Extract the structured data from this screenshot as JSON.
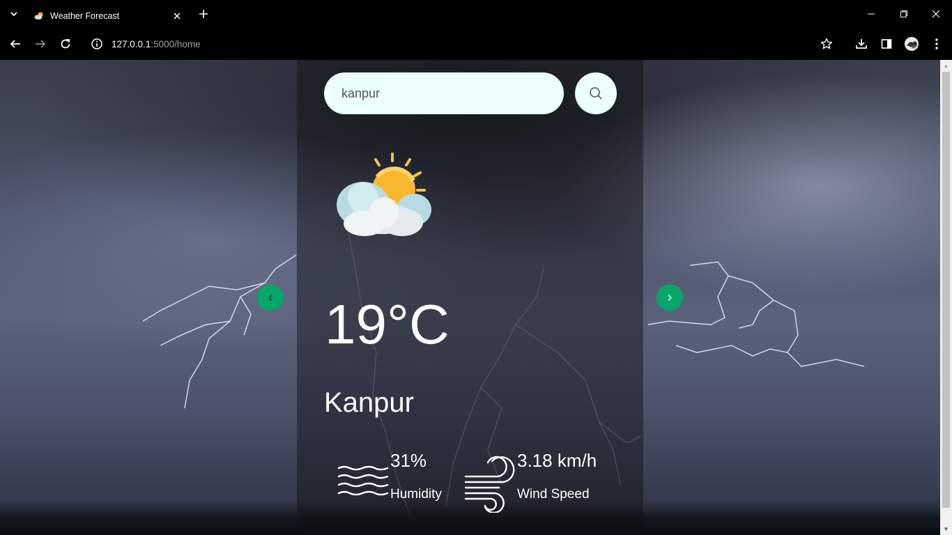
{
  "browser": {
    "tab_title": "Weather Forecast",
    "url_host": "127.0.0.1",
    "url_path": ":5000/home"
  },
  "weather": {
    "search_value": "kanpur",
    "temperature": "19°C",
    "city": "Kanpur",
    "humidity_value": "31%",
    "humidity_label": "Humidity",
    "wind_value": "3.18 km/h",
    "wind_label": "Wind Speed",
    "prev_label": "‹",
    "next_label": "›"
  },
  "colors": {
    "accent": "#06a769",
    "search_bg": "#ebfffc"
  },
  "icons": [
    "chevron-down-icon",
    "cloud-sun-icon",
    "close-icon",
    "plus-icon",
    "minimize-icon",
    "restore-icon",
    "window-close-icon",
    "back-arrow-icon",
    "forward-arrow-icon",
    "reload-icon",
    "info-icon",
    "star-icon",
    "download-icon",
    "side-panel-icon",
    "profile-icon",
    "more-vert-icon",
    "search-icon",
    "waves-icon",
    "wind-icon"
  ]
}
